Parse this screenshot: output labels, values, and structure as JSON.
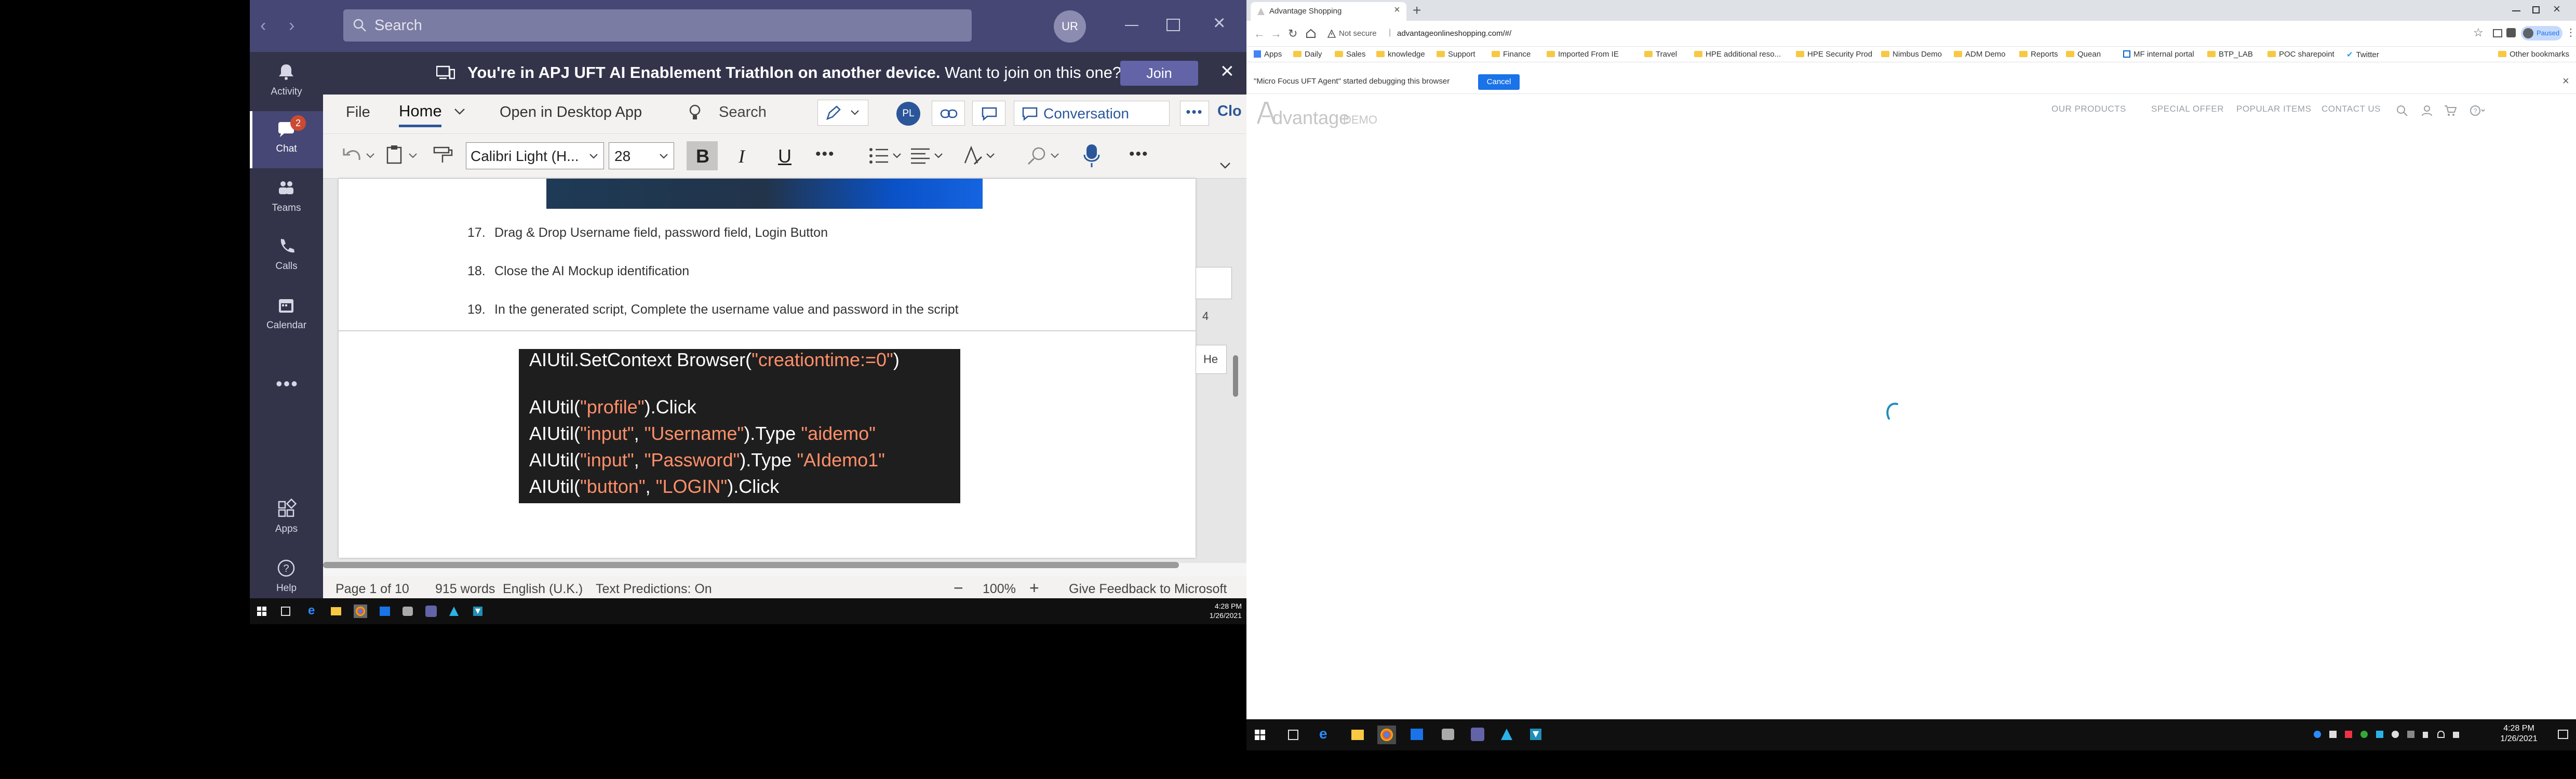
{
  "teams": {
    "search_placeholder": "Search",
    "user_initials": "UR",
    "rail": [
      {
        "label": "Activity",
        "icon": "bell-icon"
      },
      {
        "label": "Chat",
        "icon": "chat-icon",
        "badge": "2"
      },
      {
        "label": "Teams",
        "icon": "teams-icon"
      },
      {
        "label": "Calls",
        "icon": "phone-icon"
      },
      {
        "label": "Calendar",
        "icon": "calendar-icon"
      },
      {
        "label": "Apps",
        "icon": "apps-icon"
      },
      {
        "label": "Help",
        "icon": "help-icon"
      }
    ],
    "banner": {
      "bold": "You're in APJ UFT AI Enablement Triathlon on another device.",
      "normal": "Want to join on this one?",
      "join_label": "Join"
    }
  },
  "word": {
    "tabs": {
      "file": "File",
      "home": "Home",
      "open_desktop": "Open in Desktop App",
      "search": "Search",
      "avatar": "PL",
      "conversation": "Conversation",
      "close": "Clo"
    },
    "font_name": "Calibri Light (H...",
    "font_size": "28",
    "doc": {
      "steps": [
        {
          "num": "17.",
          "text": "Drag & Drop Username field, password field, Login Button"
        },
        {
          "num": "18.",
          "text": "Close the AI Mockup identification"
        },
        {
          "num": "19.",
          "text": "In the generated script, Complete the username value and password in the script"
        }
      ],
      "side_page_num": "4",
      "side_label": "He",
      "code": {
        "l1_a": "AIUtil.SetContext Browser(",
        "l1_s": "\"creationtime:=0\"",
        "l1_b": ")",
        "l2_a": "AIUtil(",
        "l2_s": "\"profile\"",
        "l2_b": ").Click",
        "l3_a": "AIUtil(",
        "l3_s1": "\"input\"",
        "l3_m": ", ",
        "l3_s2": "\"Username\"",
        "l3_b": ").Type ",
        "l3_s3": "\"aidemo\"",
        "l4_a": "AIUtil(",
        "l4_s1": "\"input\"",
        "l4_m": ", ",
        "l4_s2": "\"Password\"",
        "l4_b": ").Type  ",
        "l4_s3": "\"AIdemo1\"",
        "l5_a": "AIUtil(",
        "l5_s1": "\"button\"",
        "l5_m": ", ",
        "l5_s2": "\"LOGIN\"",
        "l5_b": ").Click"
      }
    },
    "status": {
      "page": "Page 1 of 10",
      "words": "915 words",
      "lang": "English (U.K.)",
      "predictions": "Text Predictions: On",
      "zoom": "100%",
      "feedback": "Give Feedback to Microsoft"
    }
  },
  "taskbar_left": {
    "time": "4:28 PM",
    "date": "1/26/2021"
  },
  "chrome": {
    "tab_title": "Advantage Shopping",
    "not_secure": "Not secure",
    "url": "advantageonlineshopping.com/#/",
    "profile": "Paused",
    "bookmarks": [
      "Apps",
      "Daily",
      "Sales",
      "knowledge",
      "Support",
      "Finance",
      "Imported From IE",
      "Travel",
      "HPE additional reso...",
      "HPE Security Prod",
      "Nimbus Demo",
      "ADM Demo",
      "Reports",
      "Quean",
      "MF internal portal",
      "BTP_LAB",
      "POC sharepoint",
      "Twitter"
    ],
    "other_bookmarks": "Other bookmarks",
    "debug_msg": "\"Micro Focus UFT Agent\" started debugging this browser",
    "debug_cancel": "Cancel"
  },
  "site": {
    "logo_main": "dvantage",
    "logo_sub": "DEMO",
    "nav": [
      "OUR PRODUCTS",
      "SPECIAL OFFER",
      "POPULAR ITEMS",
      "CONTACT US"
    ]
  },
  "taskbar_right": {
    "time": "4:28 PM",
    "date": "1/26/2021"
  },
  "colors": {
    "teams_purple": "#464775",
    "rail": "#33344a",
    "join": "#6264a7",
    "cancel_blue": "#1a73e8",
    "spinner": "#1f8fb8"
  }
}
